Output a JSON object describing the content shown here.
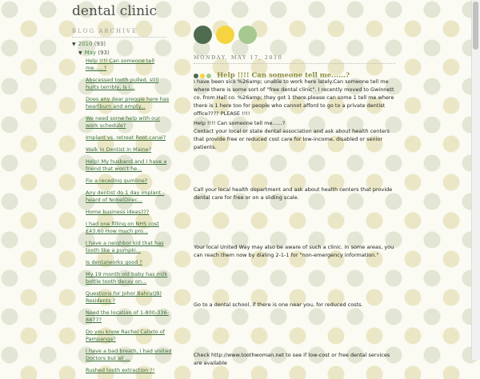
{
  "blog": {
    "title": "dental clinic"
  },
  "sidebar": {
    "archive_heading": "BLOG ARCHIVE",
    "year": {
      "toggle": "▼",
      "label": "2010",
      "count": "(93)"
    },
    "month": {
      "toggle": "▼",
      "label": "May",
      "count": "(93)"
    },
    "posts": [
      "Help !!!! Can someone tell me......?",
      "Abscessed tooth pulled, still hurts terribly, is i...",
      "Does any dear preggie here has heartburn and empty...",
      "We need some help with our work schedule?",
      "Implant vs. retreat Root canal?",
      "Walk in Dentist in Maine?",
      "Help! My husband and I have a friend that won't he...",
      "Fix a receding gumline?",
      "Any dentist do 1 day implant - heard of NobelDirec...",
      "Home business ideas???",
      "I had one filling on NHS cost £43.60 How much pro...",
      "I have a neighbor kid that has tooth like a pumpki...",
      "Is dentalworks good ?",
      "My 19 month old baby has milk bottle tooth decay on...",
      "Questions for Johor Bahru(JB) Residents ?",
      "Need the location of 1-800-336-8877?",
      "Do you know Rachel Calixto of Pampanga?",
      "I have a bad breath, i had visited Doctors but all ...",
      "Rushed tooth extraction ?!"
    ]
  },
  "main": {
    "dot_colors": [
      "#4f6b4f",
      "#f5d440",
      "#a5c98e"
    ],
    "date_header": "MONDAY, MAY 17, 2010",
    "post_title": "Help !!!! Can someone tell me......?",
    "paragraphs": [
      "I have been sick %26amp; unable to work here lately.Can someone tell me where there is some sort of \"free dental clinic\". I recently moved to Gwinnett co. from Hall co. %26amp; they got 1 there.please can some 1 tell me where there is 1 here too for people who cannot afford to go to a private dentist office???? PLEASE !!!!",
      "Help !!!! Can someone tell me......?",
      "Contact your local or state dental association and ask about health centers that provide free or reduced cost care for low-income, disabled or senior patients.",
      "Call your local health department and ask about health centers that provide dental care for free or on a sliding scale.",
      "Your local United Way may also be aware of such a clinic. In some areas, you can reach them now by dialing 2-1-1 for \"non-emergency information.\"",
      "Go to a dental school, if there is one near you, for reduced costs.",
      "Check http://www.toothwoman.net to see if low-cost or free dental services are available"
    ]
  }
}
